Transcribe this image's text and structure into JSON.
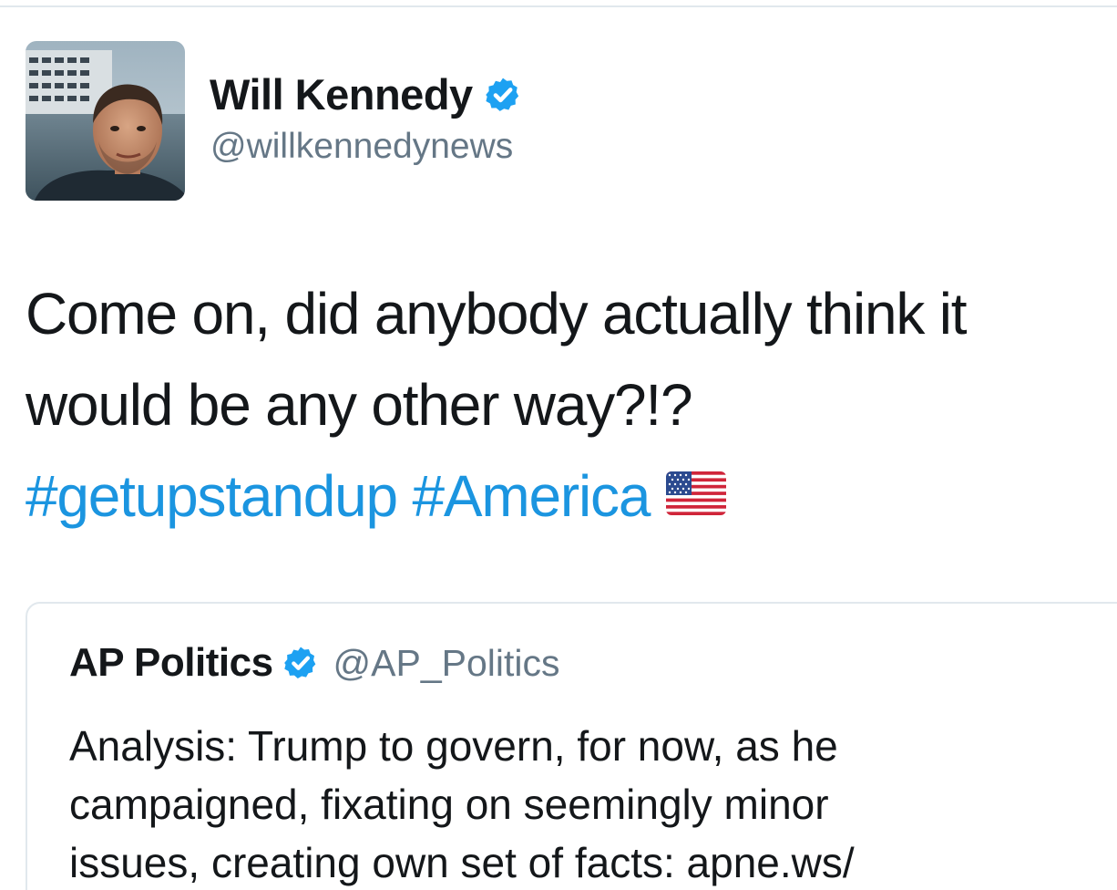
{
  "tweet": {
    "author": {
      "name": "Will Kennedy",
      "handle": "@willkennedynews",
      "verified": true
    },
    "text_lines": [
      "Come on, did anybody actually think it",
      "would be any other way?!?"
    ],
    "hashtags": [
      "#getupstandup",
      "#America"
    ],
    "emoji": "us-flag-emoji"
  },
  "quoted_tweet": {
    "author": {
      "name": "AP Politics",
      "handle": "@AP_Politics",
      "verified": true
    },
    "text_lines": [
      "Analysis: Trump to govern, for now, as he",
      "campaigned, fixating on seemingly minor",
      "issues, creating own set of facts: apne.ws/"
    ]
  },
  "colors": {
    "link": "#1b95e0",
    "verified": "#1da1f2",
    "text": "#14171a",
    "muted": "#657786",
    "border": "#e1e8ed"
  }
}
